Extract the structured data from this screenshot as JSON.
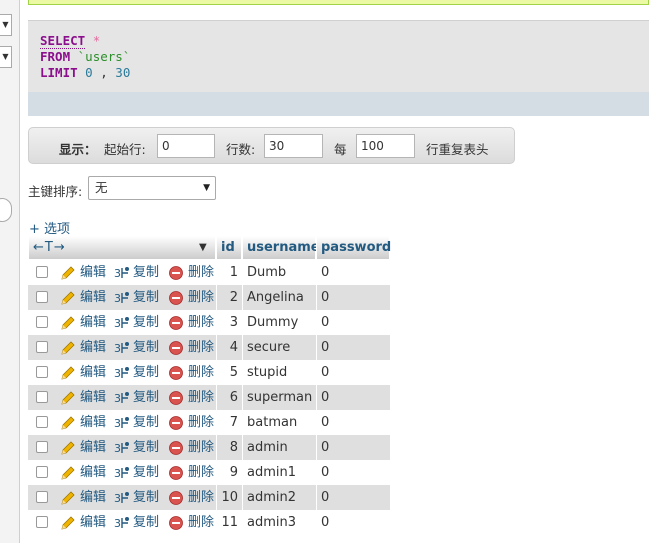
{
  "sql": {
    "select_kw": "SELECT",
    "star": "*",
    "from_kw": "FROM",
    "table_name": "`users`",
    "limit_kw": "LIMIT",
    "offset": "0",
    "comma": ",",
    "count": "30"
  },
  "navigation": {
    "show_label": "显示：",
    "start_label": "起始行:",
    "start_value": "0",
    "rows_label": "行数:",
    "rows_value": "30",
    "every_label": "每",
    "repeat_value": "100",
    "repeat_label": "行重复表头"
  },
  "sort": {
    "label": "主键排序:",
    "selected": "无"
  },
  "options_link": "+ 选项",
  "table": {
    "arrows": "←T→",
    "columns": [
      "id",
      "username",
      "password"
    ],
    "actions": {
      "edit": "编辑",
      "copy": "复制",
      "delete": "删除"
    },
    "rows": [
      {
        "id": "1",
        "username": "Dumb",
        "password": "0"
      },
      {
        "id": "2",
        "username": "Angelina",
        "password": "0"
      },
      {
        "id": "3",
        "username": "Dummy",
        "password": "0"
      },
      {
        "id": "4",
        "username": "secure",
        "password": "0"
      },
      {
        "id": "5",
        "username": "stupid",
        "password": "0"
      },
      {
        "id": "6",
        "username": "superman",
        "password": "0"
      },
      {
        "id": "7",
        "username": "batman",
        "password": "0"
      },
      {
        "id": "8",
        "username": "admin",
        "password": "0"
      },
      {
        "id": "9",
        "username": "admin1",
        "password": "0"
      },
      {
        "id": "10",
        "username": "admin2",
        "password": "0"
      },
      {
        "id": "11",
        "username": "admin3",
        "password": "0"
      }
    ]
  },
  "colors": {
    "link": "#235a81",
    "keyword": "#8b0e8d",
    "delete_icon": "#d9534f",
    "edit_icon": "#f0b400"
  }
}
